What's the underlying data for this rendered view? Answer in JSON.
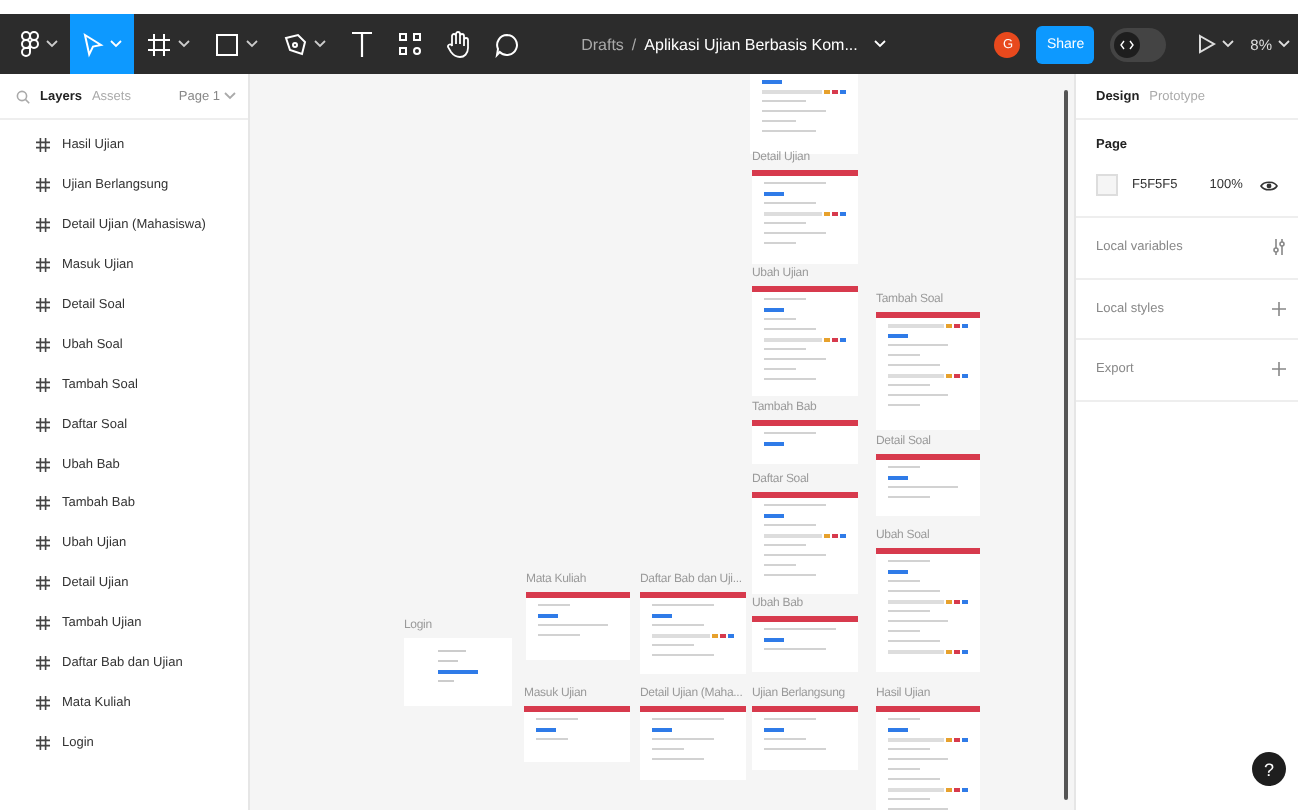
{
  "toolbar": {
    "tools": [
      {
        "kind": "logo",
        "selected": false,
        "caret": true
      },
      {
        "kind": "move",
        "selected": true,
        "caret": true
      },
      {
        "kind": "frame",
        "selected": false,
        "caret": true
      },
      {
        "kind": "shape",
        "selected": false,
        "caret": true
      },
      {
        "kind": "pen",
        "selected": false,
        "caret": true
      },
      {
        "kind": "text",
        "selected": false,
        "caret": false
      },
      {
        "kind": "components",
        "selected": false,
        "caret": false
      },
      {
        "kind": "hand",
        "selected": false,
        "caret": false
      },
      {
        "kind": "comment",
        "selected": false,
        "caret": false
      }
    ],
    "breadcrumb": {
      "folder": "Drafts",
      "separator": "/",
      "file": "Aplikasi Ujian Berbasis Kom..."
    },
    "avatar": "G",
    "share": "Share",
    "dev_mode": false,
    "zoom": "8%"
  },
  "left_panel": {
    "tabs": [
      {
        "label": "Layers",
        "selected": true
      },
      {
        "label": "Assets",
        "selected": false
      }
    ],
    "page": "Page 1",
    "layers": [
      "Hasil Ujian",
      "Ujian Berlangsung",
      "Detail Ujian (Mahasiswa)",
      "Masuk Ujian",
      "Detail Soal",
      "Ubah Soal",
      "Tambah Soal",
      "Daftar Soal",
      "Ubah Bab",
      "Tambah Bab",
      "Ubah Ujian",
      "Detail Ujian",
      "Tambah Ujian",
      "Daftar Bab dan Ujian",
      "Mata Kuliah",
      "Login"
    ]
  },
  "canvas": {
    "frames": [
      {
        "cut_off": true
      },
      {
        "label": "Detail Ujian",
        "cut_off": false
      },
      {
        "label": "Ubah Ujian",
        "cut_off": false
      },
      {
        "label": "Tambah Soal",
        "cut_off": false
      },
      {
        "label": "Tambah Bab",
        "cut_off": false
      },
      {
        "label": "Detail Soal",
        "cut_off": false
      },
      {
        "label": "Daftar Soal",
        "cut_off": false
      },
      {
        "label": "Ubah Soal",
        "cut_off": false
      },
      {
        "label": "Ubah Bab",
        "cut_off": false
      },
      {
        "label": "Login",
        "cut_off": false
      },
      {
        "label": "Mata Kuliah",
        "cut_off": false
      },
      {
        "label": "Daftar Bab dan Uji...",
        "cut_off": false
      },
      {
        "label": "Masuk Ujian",
        "cut_off": false
      },
      {
        "label": "Detail Ujian (Maha...",
        "cut_off": false
      },
      {
        "label": "Ujian Berlangsung",
        "cut_off": false
      },
      {
        "label": "Hasil Ujian",
        "cut_off": false
      }
    ],
    "help": "?"
  },
  "right_panel": {
    "tabs": [
      {
        "label": "Design",
        "selected": true
      },
      {
        "label": "Prototype",
        "selected": false
      }
    ],
    "page": {
      "title": "Page",
      "color": "F5F5F5",
      "opacity": "100%"
    },
    "sections": [
      {
        "label": "Local variables",
        "kind": "variables"
      },
      {
        "label": "Local styles",
        "kind": "add"
      },
      {
        "label": "Export",
        "kind": "add"
      }
    ]
  }
}
